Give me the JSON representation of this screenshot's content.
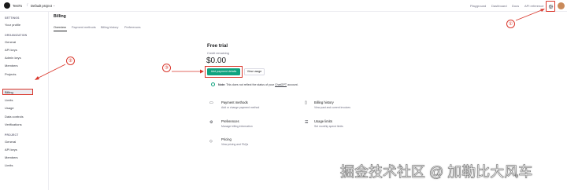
{
  "topbar": {
    "org": "TestTo",
    "project": "Default project",
    "nav": [
      "Playground",
      "Dashboard",
      "Docs",
      "API reference"
    ]
  },
  "sidebar": {
    "settings_heading": "SETTINGS",
    "settings_items": [
      "Your profile"
    ],
    "org_heading": "ORGANIZATION",
    "org_items": [
      "General",
      "API keys",
      "Admin keys",
      "Members",
      "Projects",
      "Billing",
      "Limits",
      "Usage",
      "Data controls",
      "Verifications"
    ],
    "project_heading": "PROJECT",
    "project_items": [
      "General",
      "API keys",
      "Members",
      "Limits"
    ]
  },
  "main": {
    "title": "Billing",
    "tabs": [
      "Overview",
      "Payment methods",
      "Billing history",
      "Preferences"
    ],
    "plan_title": "Free trial",
    "credit_label": "Credit remaining",
    "credit_amount": "$0.00",
    "add_payment_label": "Add payment details",
    "view_usage_label": "View usage",
    "note_prefix": "Note:",
    "note_text": "This does not reflect the status of your",
    "note_link": "ChatGPT",
    "note_suffix": "account.",
    "cards": [
      {
        "title": "Payment methods",
        "desc": "Add or change payment method"
      },
      {
        "title": "Billing history",
        "desc": "View past and current invoices"
      },
      {
        "title": "Preferences",
        "desc": "Manage billing information"
      },
      {
        "title": "Usage limits",
        "desc": "Set monthly spend limits"
      },
      {
        "title": "Pricing",
        "desc": "View pricing and FAQs"
      }
    ]
  },
  "annotations": [
    "①",
    "②",
    "③"
  ],
  "watermark": "掘金技术社区 @ 加勒比大风车",
  "colors": {
    "accent": "#10a37f",
    "annotation": "#d9362b"
  }
}
